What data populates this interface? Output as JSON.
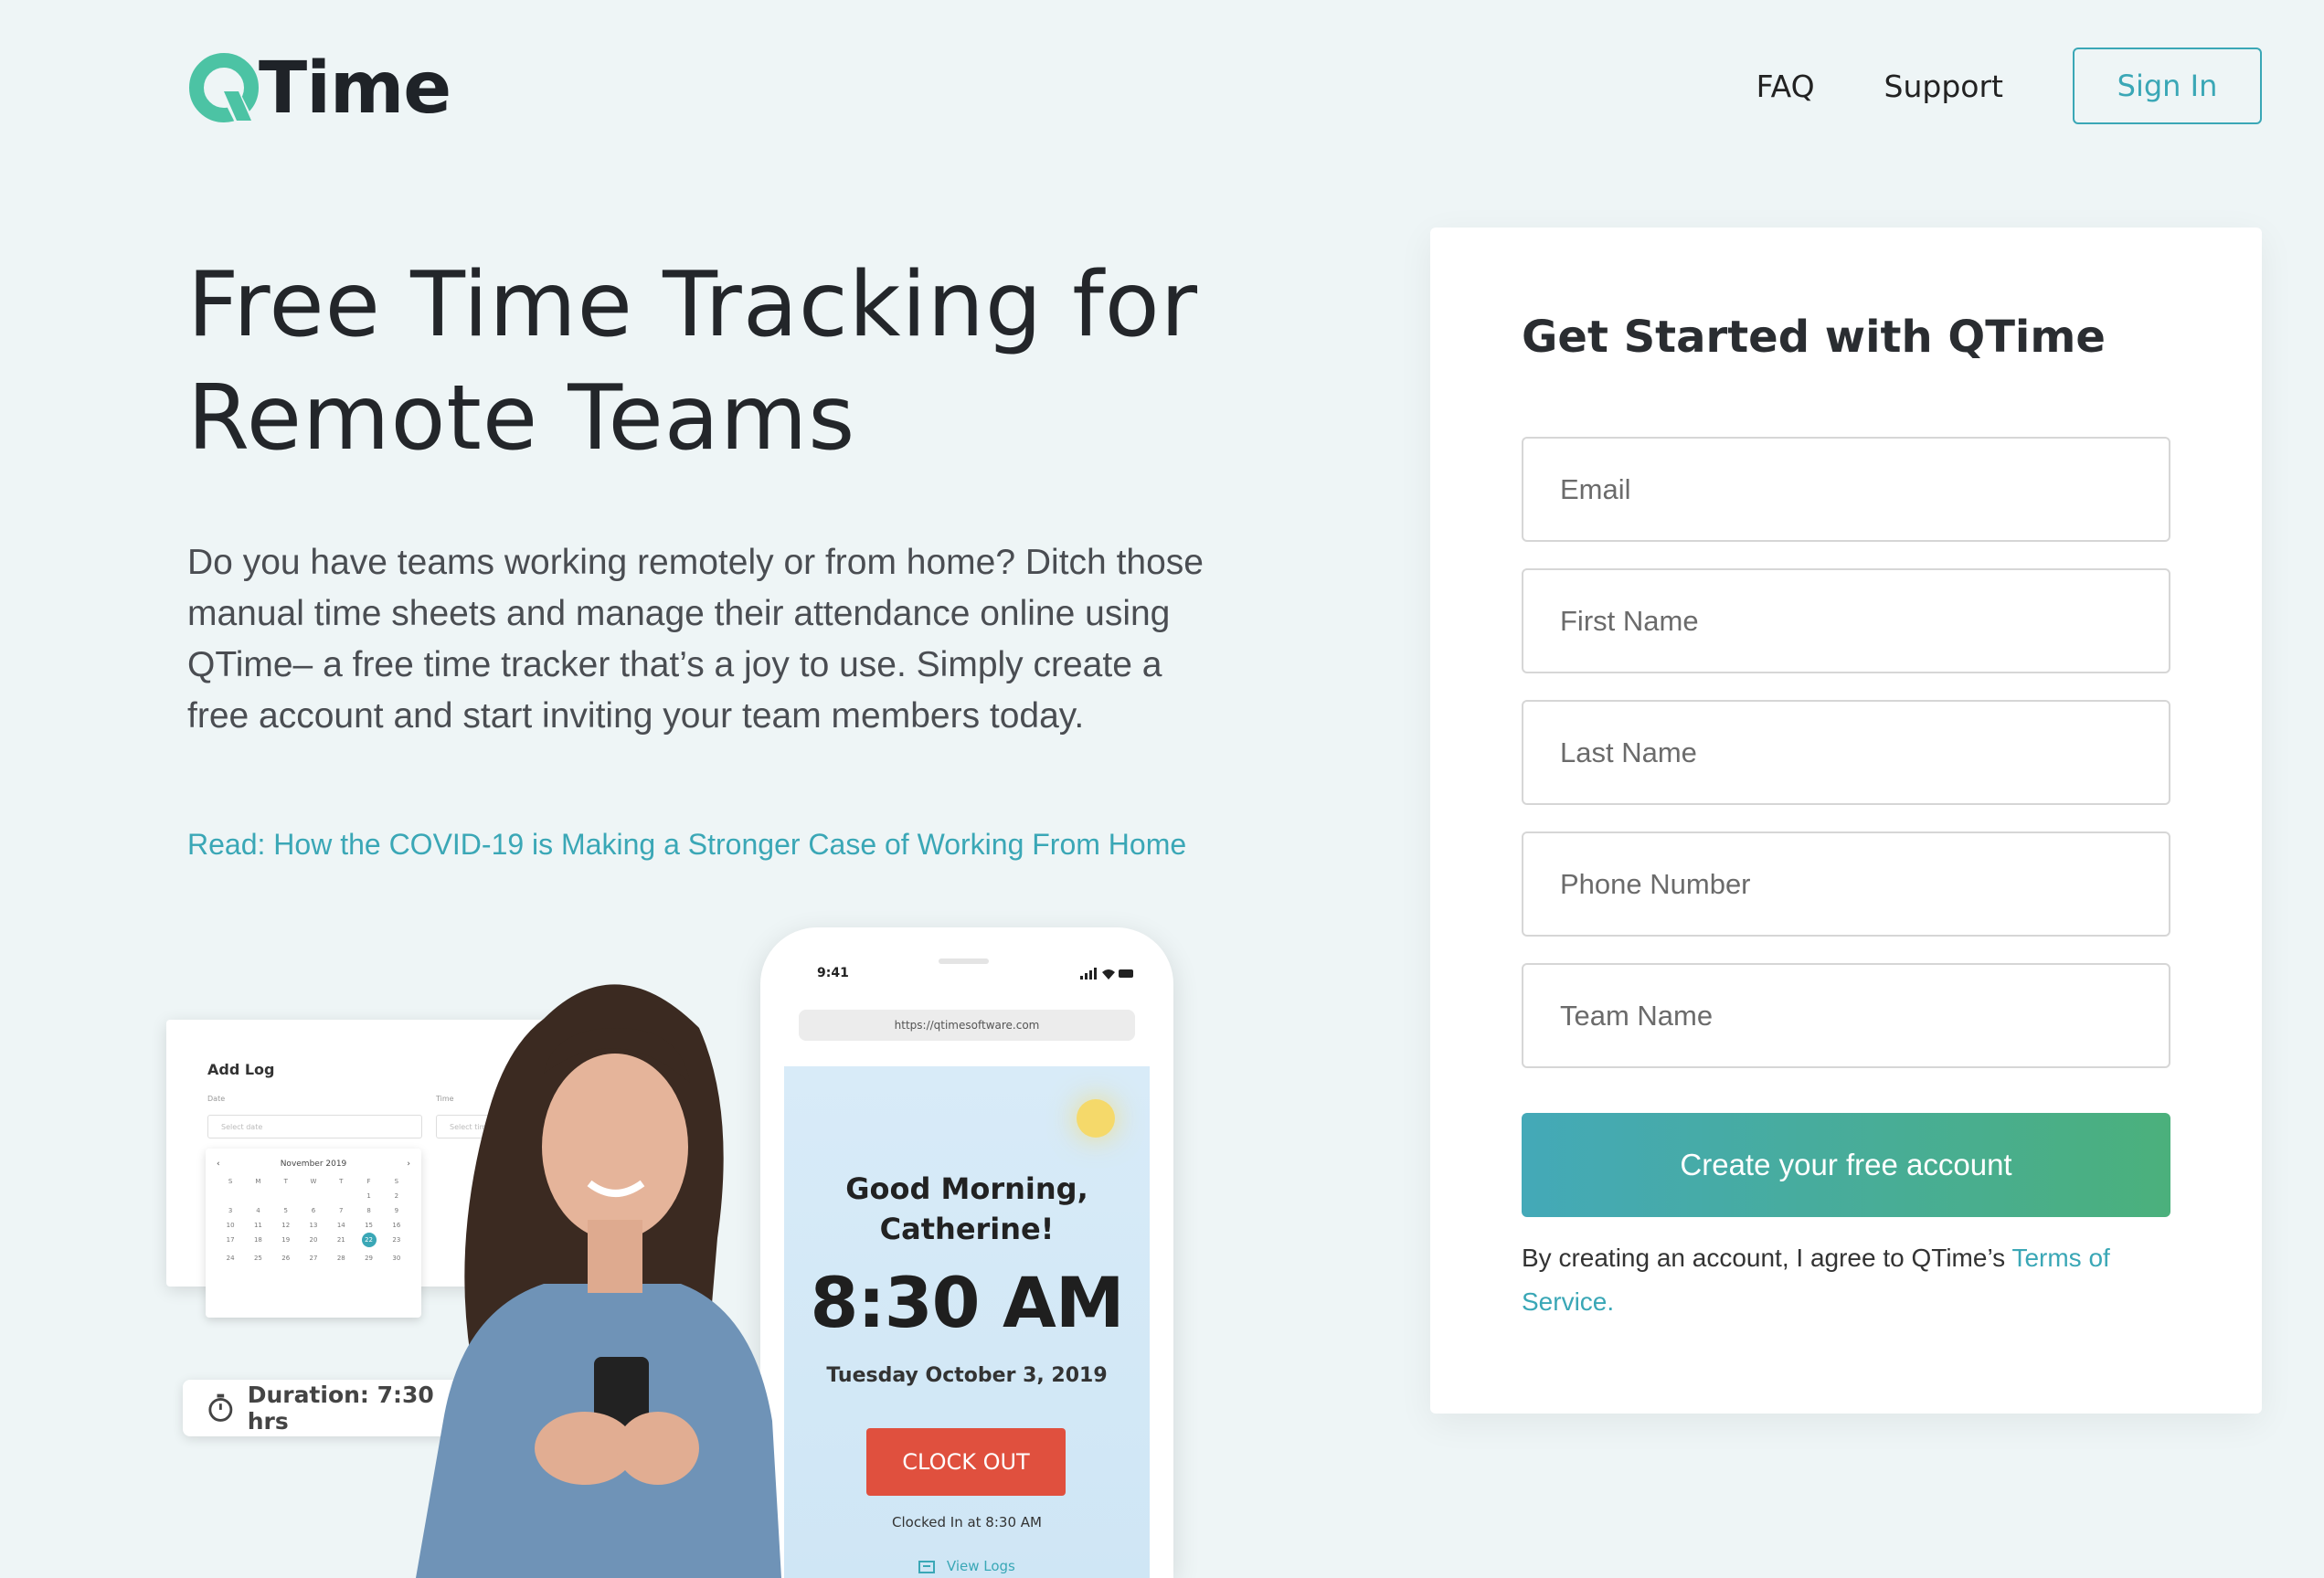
{
  "header": {
    "logo_text": "Time",
    "nav": {
      "faq": "FAQ",
      "support": "Support",
      "signin": "Sign In"
    }
  },
  "hero": {
    "title_line1": "Free Time Tracking for",
    "title_line2": "Remote Teams",
    "description": "Do you have teams working remotely or from home? Ditch those manual time sheets and manage their attendance online using QTime– a free time tracker that’s a joy to use. Simply create a free account and start inviting your team members today.",
    "link": "Read: How the COVID-19 is Making a Stronger Case of Working From Home"
  },
  "illustration": {
    "add_log": {
      "title": "Add Log",
      "date_label": "Date",
      "time_label": "Time",
      "date_placeholder": "Select date",
      "time_placeholder": "Select time"
    },
    "calendar": {
      "month": "November 2019",
      "prev": "‹",
      "next": "›",
      "weekdays": [
        "S",
        "M",
        "T",
        "W",
        "T",
        "F",
        "S"
      ],
      "days": [
        "",
        "",
        "",
        "",
        "",
        "1",
        "2",
        "3",
        "4",
        "5",
        "6",
        "7",
        "8",
        "9",
        "10",
        "11",
        "12",
        "13",
        "14",
        "15",
        "16",
        "17",
        "18",
        "19",
        "20",
        "21",
        "22",
        "23",
        "24",
        "25",
        "26",
        "27",
        "28",
        "29",
        "30"
      ],
      "selected": "22"
    },
    "duration": "Duration: 7:30 hrs",
    "phone": {
      "status_time": "9:41",
      "url": "https://qtimesoftware.com",
      "greeting_line1": "Good Morning,",
      "greeting_line2": "Catherine!",
      "time": "8:30 AM",
      "date": "Tuesday October 3, 2019",
      "clock_out": "CLOCK OUT",
      "clocked_in": "Clocked In at 8:30 AM",
      "view_logs": "View Logs"
    }
  },
  "form": {
    "title": "Get Started with QTime",
    "email_placeholder": "Email",
    "first_name_placeholder": "First Name",
    "last_name_placeholder": "Last Name",
    "phone_placeholder": "Phone Number",
    "team_placeholder": "Team Name",
    "submit": "Create your free account",
    "terms_prefix": "By creating an account, I agree to QTime’s ",
    "terms_link": "Terms of Service."
  },
  "colors": {
    "accent": "#3aa7b6",
    "logo_green": "#4cc3a4",
    "clock_out": "#e0503e",
    "background": "#eef5f6"
  },
  "icons": [
    "qtime-logo-icon",
    "stopwatch-icon",
    "signal-icon",
    "logs-icon"
  ]
}
